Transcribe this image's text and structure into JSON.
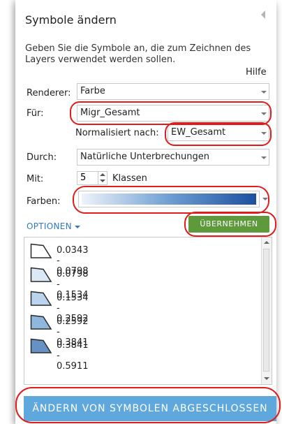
{
  "panel": {
    "title": "Symbole ändern",
    "description": "Geben Sie die Symbole an, die zum Zeichnen des Layers verwendet werden sollen.",
    "help_link": "Hilfe"
  },
  "renderer": {
    "label": "Renderer:",
    "value": "Farbe"
  },
  "fuer": {
    "label": "Für:",
    "value": "Migr_Gesamt"
  },
  "normalize": {
    "label": "Normalisiert nach:",
    "value": "EW_Gesamt"
  },
  "durch": {
    "label": "Durch:",
    "value": "Natürliche Unterbrechungen"
  },
  "mit": {
    "label": "Mit:",
    "value": "5",
    "suffix": "Klassen"
  },
  "farben": {
    "label": "Farben:"
  },
  "options_link": "OPTIONEN",
  "apply_button": "ÜBERNEHMEN",
  "classes": [
    {
      "label": "0.0343 - 0.0798",
      "color": "#ffffff"
    },
    {
      "label": "0.0798 - 0.1534",
      "color": "#dbe9f6"
    },
    {
      "label": "0.1534 - 0.2592",
      "color": "#b9d4ec"
    },
    {
      "label": "0.2592 - 0.3841",
      "color": "#8fb6dd"
    },
    {
      "label": "0.3841 - 0.5911",
      "color": "#6791c4"
    }
  ],
  "done_button": "ÄNDERN VON SYMBOLEN ABGESCHLOSSEN",
  "colors": {
    "apply_green": "#5e9a3b",
    "done_blue": "#5ea8dd",
    "link_blue": "#2f79c2",
    "highlight_red": "#e21b1b"
  }
}
